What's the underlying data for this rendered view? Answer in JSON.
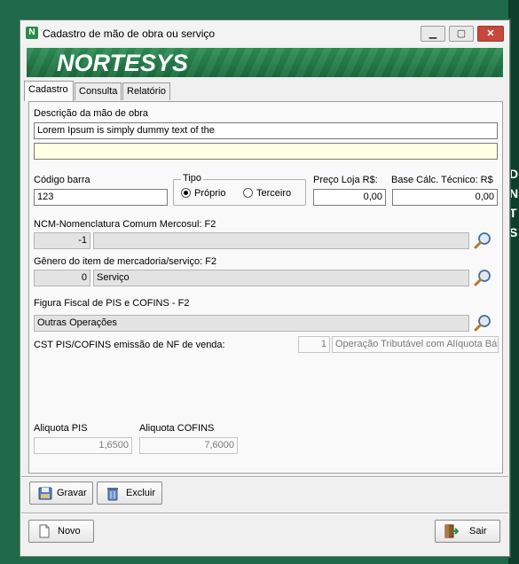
{
  "window": {
    "title": "Cadastro de  mão de obra ou serviço",
    "logo_text": "NORTESYS",
    "minimize_glyph": "▁",
    "maximize_glyph": "▢",
    "close_glyph": "✕"
  },
  "tabs": [
    {
      "label": "Cadastro",
      "active": true
    },
    {
      "label": "Consulta",
      "active": false
    },
    {
      "label": "Relatório",
      "active": false
    }
  ],
  "form": {
    "descricao_label": "Descrição da mão de obra",
    "descricao_value": "Lorem Ipsum is simply dummy text of the",
    "descricao2_value": "",
    "codigo_barra_label": "Código barra",
    "codigo_barra_value": "123",
    "tipo_label": "Tipo",
    "tipo_options": [
      "Próprio",
      "Terceiro"
    ],
    "tipo_selected": "Próprio",
    "preco_loja_label": "Preço Loja R$:",
    "preco_loja_value": "0,00",
    "base_calc_label": "Base Cálc. Técnico: R$",
    "base_calc_value": "0,00",
    "ncm_label": "NCM-Nomenclatura Comum Mercosul: F2",
    "ncm_code": "-1",
    "ncm_desc": "",
    "genero_label": "Gênero do item de mercadoria/serviço: F2",
    "genero_code": "0",
    "genero_desc": "Serviço",
    "figura_label": "Figura Fiscal de PIS e COFINS - F2",
    "figura_value": "Outras Operações",
    "cst_label": "CST PIS/COFINS emissão de NF de venda:",
    "cst_code": "1",
    "cst_desc": "Operação Tributável com Alíquota Bás",
    "aliquota_pis_label": "Aliquota PIS",
    "aliquota_pis_value": "1,6500",
    "aliquota_cofins_label": "Aliquota COFINS",
    "aliquota_cofins_value": "7,6000"
  },
  "buttons": {
    "gravar": "Gravar",
    "excluir": "Excluir",
    "novo": "Novo",
    "sair": "Sair"
  },
  "background": {
    "right_letters": [
      "D",
      "N",
      "T",
      "S"
    ]
  },
  "colors": {
    "banner": "#2f8f55",
    "desktop": "#1f6a4a",
    "close_button": "#c9463a",
    "highlight_field": "#ffffe1"
  }
}
